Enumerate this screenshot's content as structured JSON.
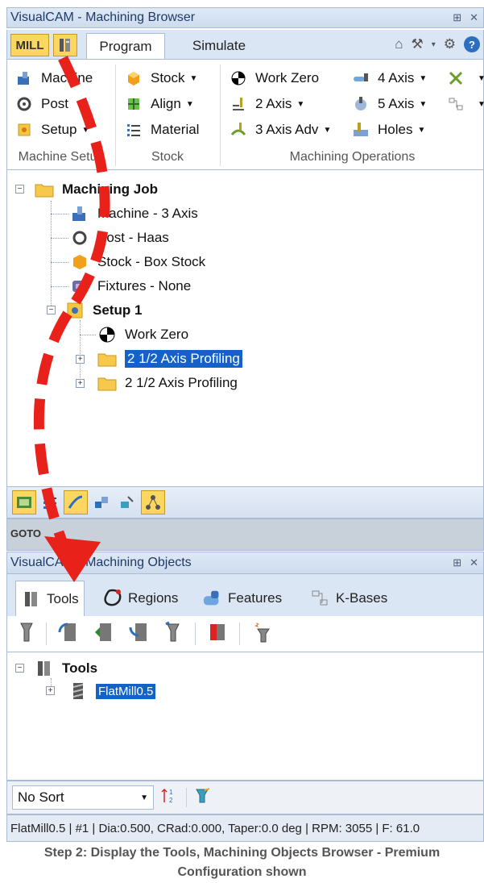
{
  "browser": {
    "title": "VisualCAM - Machining Browser",
    "pin_glyph": "⊞",
    "close_glyph": "✕",
    "mill_label": "MILL",
    "tabs": [
      {
        "label": "Program"
      },
      {
        "label": "Simulate"
      }
    ],
    "ribbon": {
      "machine_setup": {
        "items": [
          {
            "label": "Machine",
            "icon": "machine-icon"
          },
          {
            "label": "Post",
            "icon": "post-icon"
          },
          {
            "label": "Setup",
            "icon": "setup-icon"
          }
        ],
        "group_label": "Machine Setup"
      },
      "stock": {
        "items": [
          {
            "label": "Stock",
            "icon": "stock-icon"
          },
          {
            "label": "Align",
            "icon": "align-icon"
          },
          {
            "label": "Material",
            "icon": "material-icon"
          }
        ],
        "group_label": "Stock"
      },
      "machining_operations": {
        "items": [
          {
            "label": "Work Zero",
            "icon": "work-zero-icon"
          },
          {
            "label": "2 Axis",
            "icon": "2-axis-icon"
          },
          {
            "label": "3 Axis Adv",
            "icon": "3-axis-adv-icon"
          },
          {
            "label": "4 Axis",
            "icon": "4-axis-icon"
          },
          {
            "label": "5 Axis",
            "icon": "5-axis-icon"
          },
          {
            "label": "Holes",
            "icon": "holes-icon"
          }
        ],
        "group_label": "Machining Operations"
      }
    },
    "tree": {
      "root": "Machining Job",
      "items": [
        {
          "label": "Machine - 3 Axis"
        },
        {
          "label": "Post - Haas"
        },
        {
          "label": "Stock - Box Stock"
        },
        {
          "label": "Fixtures - None"
        }
      ],
      "setup": "Setup 1",
      "setup_items": [
        {
          "label": "Work Zero"
        },
        {
          "label": "2 1/2 Axis Profiling"
        },
        {
          "label": "2 1/2 Axis Profiling"
        }
      ]
    },
    "goto_label": "GOTO"
  },
  "objects": {
    "title": "VisualCAM - Machining Objects",
    "tabs": [
      {
        "label": "Tools"
      },
      {
        "label": "Regions"
      },
      {
        "label": "Features"
      },
      {
        "label": "K-Bases"
      }
    ],
    "tree_root": "Tools",
    "tree_item": "FlatMill0.5",
    "sort_value": "No Sort",
    "status": "FlatMill0.5 | #1 | Dia:0.500, CRad:0.000, Taper:0.0 deg | RPM: 3055 | F: 61.0"
  },
  "caption": {
    "line1": "Step 2: Display the Tools, Machining Objects Browser - Premium",
    "line2": "Configuration shown"
  },
  "colors": {
    "accent": "#1462c8",
    "highlight": "#fbd760",
    "arrow": "#e8221b"
  }
}
